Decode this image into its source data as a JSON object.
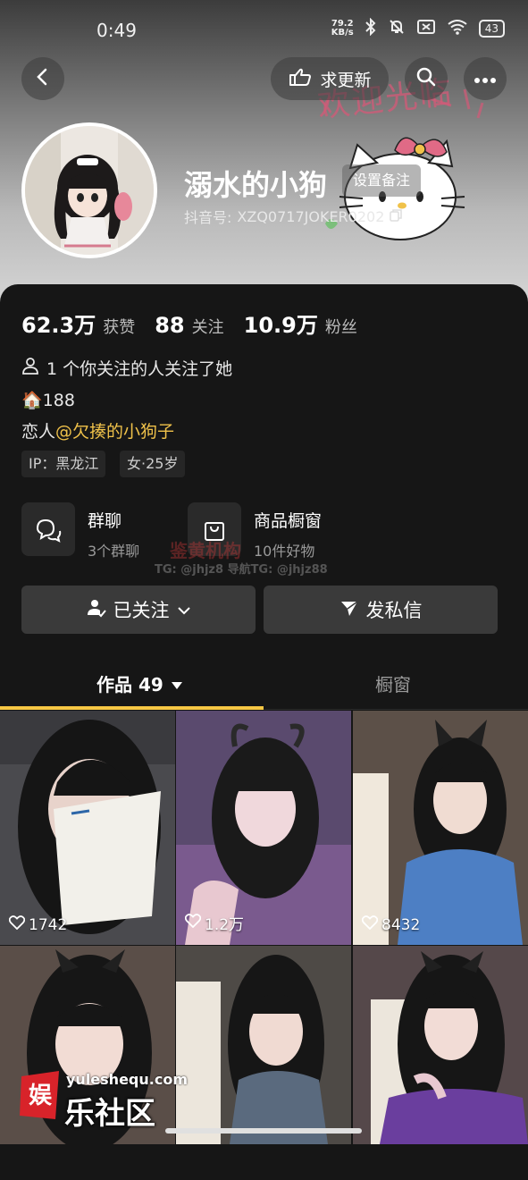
{
  "status_bar": {
    "time": "0:49",
    "net_speed_value": "79.2",
    "net_speed_unit": "KB/s",
    "battery": "43"
  },
  "header": {
    "request_update_label": "求更新",
    "back_icon": "chevron-left-icon",
    "search_icon": "search-icon",
    "more_icon": "more-horizontal-icon"
  },
  "background_sticker": {
    "text": "欢迎光临"
  },
  "profile": {
    "username": "溺水的小狗",
    "remark_button": "设置备注",
    "douyin_id_label": "抖音号:",
    "douyin_id": "XZQ0717JOKER0202"
  },
  "stats": {
    "likes_value": "62.3万",
    "likes_label": "获赞",
    "following_value": "88",
    "following_label": "关注",
    "followers_value": "10.9万",
    "followers_label": "粉丝"
  },
  "mutual_follow": "1 个你关注的人关注了她",
  "bio": {
    "line1": "🏠188",
    "line2_prefix": "恋人",
    "line2_mention": "@欠揍的小狗子"
  },
  "tags": [
    "IP：黑龙江",
    "女·25岁"
  ],
  "features": {
    "group_chat": {
      "title": "群聊",
      "sub": "3个群聊"
    },
    "shop_window": {
      "title": "商品橱窗",
      "sub": "10件好物"
    }
  },
  "overlay_watermark": {
    "line1": "鉴黄机构",
    "line2": "TG: @jhjz8 导航TG: @jhjz88"
  },
  "actions": {
    "followed": "已关注",
    "message": "发私信"
  },
  "tabs": {
    "works": "作品 49",
    "shop": "橱窗"
  },
  "videos": [
    {
      "likes": "1742"
    },
    {
      "likes": "1.2万"
    },
    {
      "likes": "8432"
    },
    {
      "likes": ""
    },
    {
      "likes": ""
    },
    {
      "likes": ""
    }
  ],
  "site_watermark": {
    "url": "yuleshequ.com",
    "name": "乐社区",
    "logo_char": "娱"
  },
  "colors": {
    "accent": "#f6c744",
    "mention": "#f0c24a",
    "panel": "#161616"
  }
}
